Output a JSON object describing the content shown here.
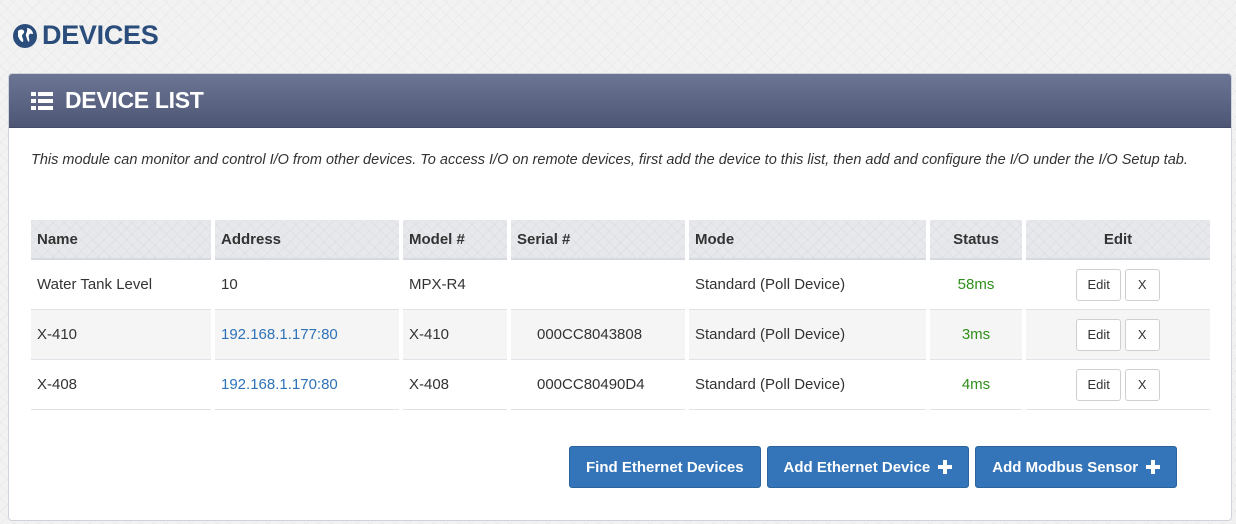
{
  "page": {
    "title": "DEVICES",
    "icon": "globe-icon"
  },
  "panel": {
    "title": "DEVICE LIST",
    "icon": "list-icon",
    "intro": "This module can monitor and control I/O from other devices. To access I/O on remote devices, first add the device to this list, then add and configure the I/O under the I/O Setup tab."
  },
  "table": {
    "headers": [
      "Name",
      "Address",
      "Model #",
      "Serial #",
      "Mode",
      "Status",
      "Edit"
    ],
    "rows": [
      {
        "name": "Water Tank Level",
        "address": "10",
        "model": "MPX-R4",
        "serial": "",
        "mode": "Standard (Poll Device)",
        "status": "58ms",
        "edit": "Edit",
        "delete": "X"
      },
      {
        "name": "X-410",
        "address": "192.168.1.177:80",
        "model": "X-410",
        "serial": "000CC8043808",
        "mode": "Standard (Poll Device)",
        "status": "3ms",
        "edit": "Edit",
        "delete": "X"
      },
      {
        "name": "X-408",
        "address": "192.168.1.170:80",
        "model": "X-408",
        "serial": "000CC80490D4",
        "mode": "Standard (Poll Device)",
        "status": "4ms",
        "edit": "Edit",
        "delete": "X"
      }
    ]
  },
  "actions": {
    "find_label": "Find Ethernet Devices",
    "add_ethernet_label": "Add Ethernet Device",
    "add_modbus_label": "Add Modbus Sensor"
  },
  "colors": {
    "title": "#2a4d7c",
    "panel_header": "#5b6483",
    "link": "#2e72b8",
    "status_ok": "#2f8f1a",
    "primary_button": "#3474b8"
  }
}
